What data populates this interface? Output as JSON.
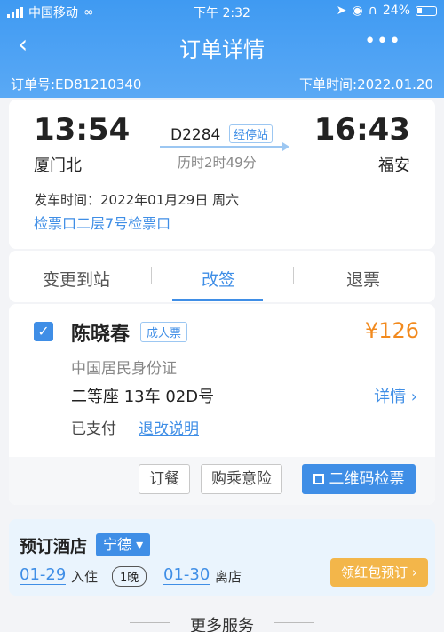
{
  "status_bar": {
    "carrier": "中国移动",
    "time": "下午 2:32",
    "battery": "24%"
  },
  "nav": {
    "title": "订单详情",
    "more": "•••"
  },
  "order": {
    "number": "订单号:ED81210340",
    "time": "下单时间:2022.01.20"
  },
  "trip": {
    "dep_time": "13:54",
    "dep_station": "厦门北",
    "arr_time": "16:43",
    "arr_station": "福安",
    "train_no": "D2284",
    "stops_label": "经停站",
    "duration": "历时2时49分",
    "departure_date": "发车时间：2022年01月29日 周六",
    "gate": "检票口二层7号检票口"
  },
  "tabs": [
    {
      "label": "变更到站"
    },
    {
      "label": "改签"
    },
    {
      "label": "退票"
    }
  ],
  "passenger": {
    "name": "陈晓春",
    "ticket_type": "成人票",
    "price": "¥126",
    "id_type": "中国居民身份证",
    "seat": "二等座 13车 02D号",
    "detail_label": "详情 ›",
    "status": "已支付",
    "refund_note": "退改说明"
  },
  "actions": {
    "meal": "订餐",
    "insurance": "购乘意险",
    "qr": "二维码检票"
  },
  "hotel": {
    "title": "预订酒店",
    "city": "宁德 ▾",
    "checkin_date": "01-29",
    "checkin_label": "入住",
    "nights": "1晚",
    "checkout_date": "01-30",
    "checkout_label": "离店",
    "coupon_button": "领红包预订 ›"
  },
  "more_services": "更多服务",
  "colors": {
    "accent": "#3f8ee6",
    "price": "#f28a1e",
    "coupon": "#f3b64a"
  }
}
